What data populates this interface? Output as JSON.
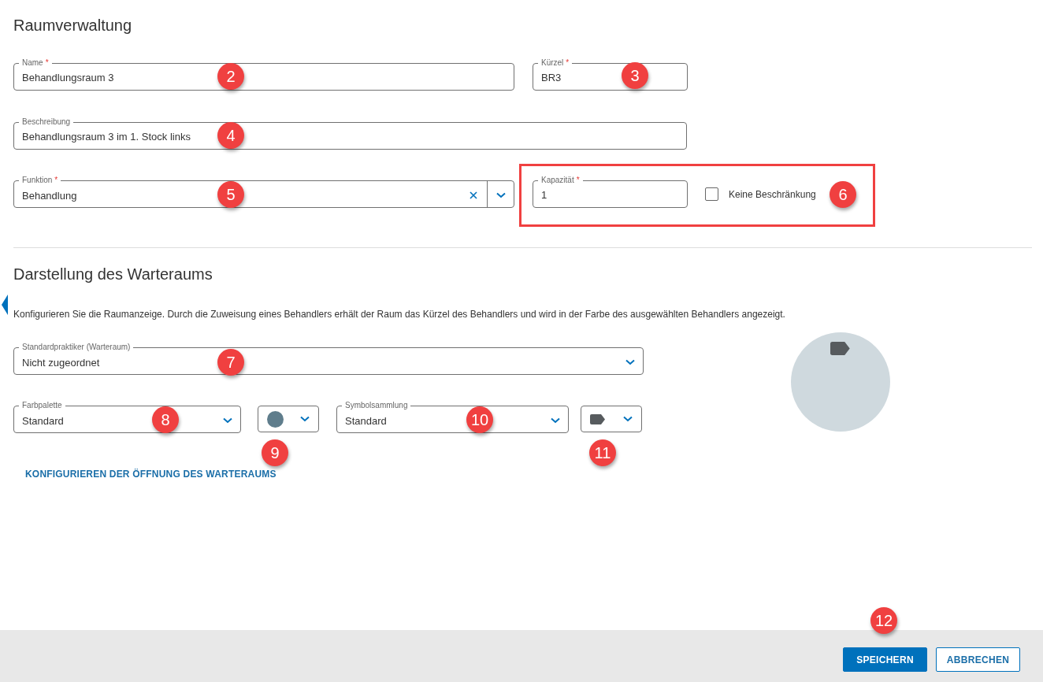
{
  "general": {
    "title": "Raumverwaltung",
    "name": {
      "label": "Name",
      "required_mark": "*",
      "value": "Behandlungsraum 3"
    },
    "abbreviation": {
      "label": "Kürzel",
      "required_mark": "*",
      "value": "BR3"
    },
    "description": {
      "label": "Beschreibung",
      "value": "Behandlungsraum 3 im 1. Stock links"
    },
    "function": {
      "label": "Funktion",
      "required_mark": "*",
      "value": "Behandlung",
      "clearable": true
    },
    "capacity_group": {
      "highlighted": true,
      "capacity": {
        "label": "Kapazität",
        "required_mark": "*",
        "value": "1"
      },
      "no_limit": {
        "label": "Keine Beschränkung",
        "checked": false
      }
    }
  },
  "waiting_room": {
    "title": "Darstellung des Warteraums",
    "description": "Konfigurieren Sie die Raumanzeige. Durch die Zuweisung eines Behandlers erhält der Raum das Kürzel des Behandlers und wird in der Farbe des ausgewählten Behandlers angezeigt.",
    "practitioner": {
      "label": "Standardpraktiker (Warteraum)",
      "value": "Nicht zugeordnet"
    },
    "palette": {
      "label": "Farbpalette",
      "value": "Standard"
    },
    "symbol_collection": {
      "label": "Symbolsammlung",
      "value": "Standard"
    },
    "link": "KONFIGURIEREN DER ÖFFNUNG DES WARTERAUMS"
  },
  "footer": {
    "buttons": [
      {
        "label": "SPEICHERN",
        "kind": "primary"
      },
      {
        "label": "ABBRECHEN",
        "kind": "secondary"
      }
    ]
  },
  "callouts": [
    {
      "number": "2"
    },
    {
      "number": "3"
    },
    {
      "number": "4"
    },
    {
      "number": "5"
    },
    {
      "number": "6"
    },
    {
      "number": "7"
    },
    {
      "number": "8"
    },
    {
      "number": "9"
    },
    {
      "number": "10"
    },
    {
      "number": "11"
    },
    {
      "number": "12"
    }
  ]
}
